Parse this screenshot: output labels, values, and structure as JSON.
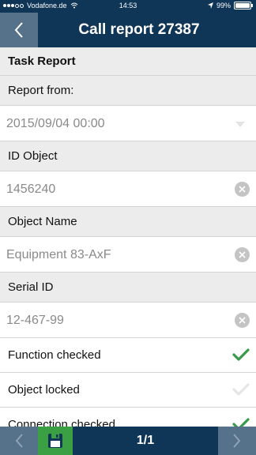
{
  "status_bar": {
    "carrier": "Vodafone.de",
    "time": "14:53",
    "battery": "99%",
    "battery_level": 0.99
  },
  "header": {
    "title": "Call report 27387"
  },
  "form": {
    "section_title": "Task Report",
    "report_from_label": "Report from:",
    "report_from_value": "2015/09/04 00:00",
    "id_object_label": "ID Object",
    "id_object_value": "1456240",
    "object_name_label": "Object Name",
    "object_name_value": "Equipment 83-AxF",
    "serial_id_label": "Serial ID",
    "serial_id_value": "12-467-99",
    "checks": [
      {
        "label": "Function checked",
        "checked": true
      },
      {
        "label": "Object locked",
        "checked": false
      },
      {
        "label": "Connection checked",
        "checked": true
      }
    ]
  },
  "footer": {
    "page_indicator": "1/1"
  },
  "colors": {
    "navy": "#0f3557",
    "slate": "#56718a",
    "save_green": "#3aa043",
    "check_green": "#3a9a4a"
  }
}
